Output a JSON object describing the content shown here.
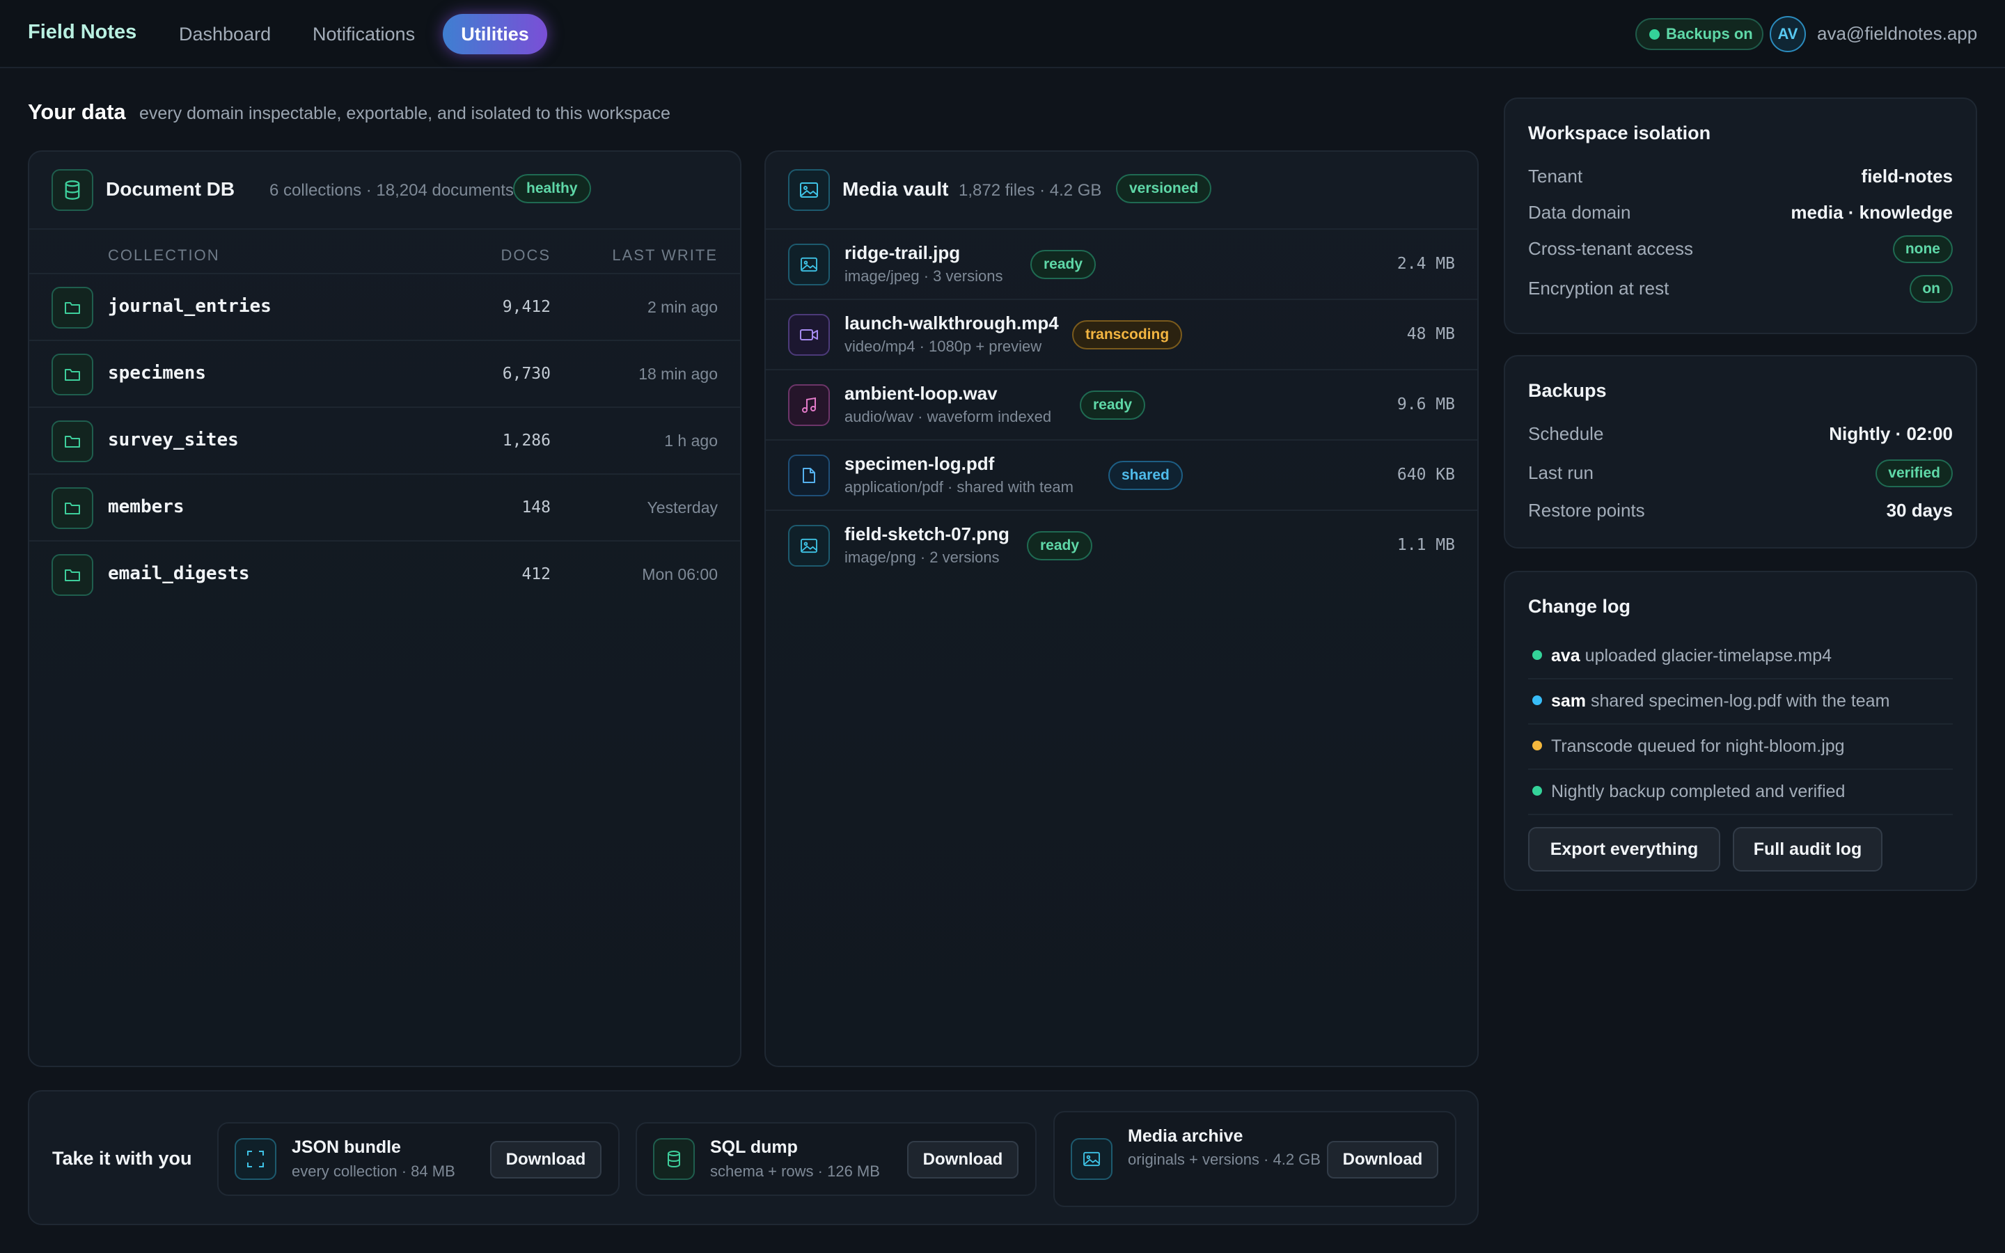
{
  "app": {
    "brand": "Field Notes",
    "nav": [
      "Dashboard",
      "Notifications",
      "Utilities"
    ],
    "active_nav": "Utilities",
    "backup_status": "Backups on",
    "avatar_initials": "AV",
    "user_email": "ava@fieldnotes.app"
  },
  "page": {
    "title": "Your data",
    "subtitle": "every domain inspectable, exportable, and isolated to this workspace"
  },
  "document_db": {
    "title": "Document DB",
    "meta": "6 collections · 18,204 documents",
    "status": "healthy",
    "columns": [
      "COLLECTION",
      "DOCS",
      "LAST WRITE"
    ],
    "rows": [
      {
        "name": "journal_entries",
        "docs": "9,412",
        "last_write": "2 min ago"
      },
      {
        "name": "specimens",
        "docs": "6,730",
        "last_write": "18 min ago"
      },
      {
        "name": "survey_sites",
        "docs": "1,286",
        "last_write": "1 h ago"
      },
      {
        "name": "members",
        "docs": "148",
        "last_write": "Yesterday"
      },
      {
        "name": "email_digests",
        "docs": "412",
        "last_write": "Mon 06:00"
      }
    ]
  },
  "media_vault": {
    "title": "Media vault",
    "meta": "1,872 files · 4.2 GB",
    "status": "versioned",
    "files": [
      {
        "name": "ridge-trail.jpg",
        "sub": "image/jpeg · 3 versions",
        "status": "ready",
        "size": "2.4 MB",
        "icon": "image-icon"
      },
      {
        "name": "launch-walkthrough.mp4",
        "sub": "video/mp4 · 1080p + preview",
        "status": "transcoding",
        "size": "48 MB",
        "icon": "video-icon"
      },
      {
        "name": "ambient-loop.wav",
        "sub": "audio/wav · waveform indexed",
        "status": "ready",
        "size": "9.6 MB",
        "icon": "music-icon"
      },
      {
        "name": "specimen-log.pdf",
        "sub": "application/pdf · shared with team",
        "status": "shared",
        "size": "640 KB",
        "icon": "file-icon"
      },
      {
        "name": "field-sketch-07.png",
        "sub": "image/png · 2 versions",
        "status": "ready",
        "size": "1.1 MB",
        "icon": "image-icon"
      }
    ]
  },
  "isolation": {
    "title": "Workspace isolation",
    "rows": [
      {
        "label": "Tenant",
        "value": "field-notes"
      },
      {
        "label": "Data domain",
        "value": "media · knowledge"
      },
      {
        "label": "Cross-tenant access",
        "value": "none"
      },
      {
        "label": "Encryption at rest",
        "value": "on"
      }
    ]
  },
  "backups": {
    "title": "Backups",
    "rows": [
      {
        "label": "Schedule",
        "value": "Nightly · 02:00"
      },
      {
        "label": "Last run",
        "value": "verified"
      },
      {
        "label": "Restore points",
        "value": "30 days"
      }
    ]
  },
  "change_log": {
    "title": "Change log",
    "items": [
      {
        "actor": "ava",
        "text": "uploaded glacier-timelapse.mp4",
        "color": "#34d399"
      },
      {
        "actor": "sam",
        "text": "shared specimen-log.pdf with the team",
        "color": "#38bdf8"
      },
      {
        "actor": "",
        "text": "Transcode queued for night-bloom.jpg",
        "color": "#f5b83d"
      },
      {
        "actor": "",
        "text": "Nightly backup completed and verified",
        "color": "#34d399"
      }
    ],
    "export_label": "Export everything",
    "audit_label": "Full audit log"
  },
  "exports": {
    "title": "Take it with you",
    "items": [
      {
        "name": "JSON bundle",
        "sub": "every collection · 84 MB",
        "button": "Download"
      },
      {
        "name": "SQL dump",
        "sub": "schema + rows · 126 MB",
        "button": "Download"
      },
      {
        "name": "Media archive",
        "sub": "originals + versions · 4.2 GB",
        "button": "Download"
      }
    ]
  },
  "colors": {
    "accent_green": "#34d399",
    "accent_blue": "#38bdf8",
    "accent_amber": "#f5b83d",
    "active_nav_gradient": [
      "#3f7fd1",
      "#7a4fd6"
    ]
  }
}
